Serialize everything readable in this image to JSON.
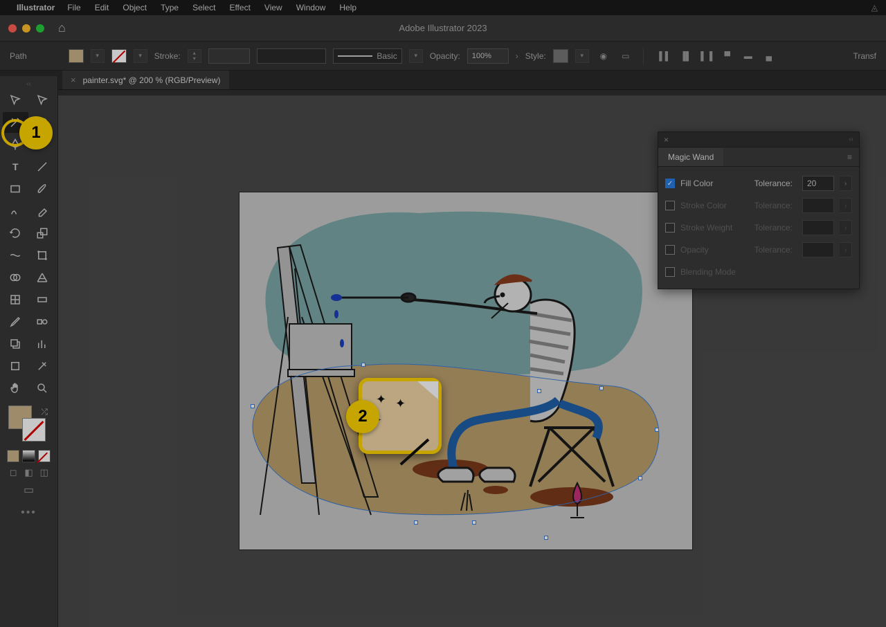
{
  "menubar": {
    "appname": "Illustrator",
    "items": [
      "File",
      "Edit",
      "Object",
      "Type",
      "Select",
      "Effect",
      "View",
      "Window",
      "Help"
    ]
  },
  "titlebar": {
    "title": "Adobe Illustrator 2023"
  },
  "controlbar": {
    "sel_label": "Path",
    "stroke_label": "Stroke:",
    "brush_label": "Basic",
    "opacity_label": "Opacity:",
    "opacity_value": "100%",
    "style_label": "Style:",
    "transform_label": "Transf"
  },
  "doctab": {
    "name": "painter.svg* @ 200 % (RGB/Preview)"
  },
  "panel": {
    "title": "Magic Wand",
    "rows": [
      {
        "key": "fill",
        "label": "Fill Color",
        "checked": true,
        "tolerance_label": "Tolerance:",
        "tolerance": "20"
      },
      {
        "key": "strokec",
        "label": "Stroke Color",
        "checked": false,
        "tolerance_label": "Tolerance:",
        "tolerance": ""
      },
      {
        "key": "strokew",
        "label": "Stroke Weight",
        "checked": false,
        "tolerance_label": "Tolerance:",
        "tolerance": ""
      },
      {
        "key": "opacity",
        "label": "Opacity",
        "checked": false,
        "tolerance_label": "Tolerance:",
        "tolerance": ""
      },
      {
        "key": "blend",
        "label": "Blending Mode",
        "checked": false
      }
    ]
  },
  "callouts": {
    "step1": "1",
    "step2": "2"
  },
  "colors": {
    "fill": "#c9b288",
    "accent": "#ffd400",
    "sel": "#3b7dd8"
  }
}
